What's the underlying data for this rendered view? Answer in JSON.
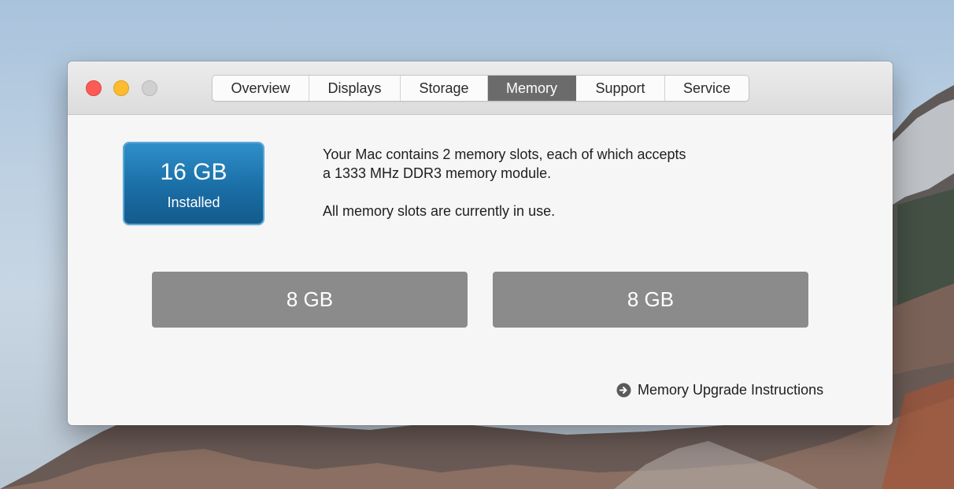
{
  "window": {
    "tabs": [
      {
        "label": "Overview",
        "active": false
      },
      {
        "label": "Displays",
        "active": false
      },
      {
        "label": "Storage",
        "active": false
      },
      {
        "label": "Memory",
        "active": true
      },
      {
        "label": "Support",
        "active": false
      },
      {
        "label": "Service",
        "active": false
      }
    ]
  },
  "memory": {
    "amount": "16 GB",
    "status": "Installed",
    "description_line1": "Your Mac contains 2 memory slots, each of which accepts",
    "description_line2": "a 1333 MHz DDR3 memory module.",
    "slots_status": "All memory slots are currently in use.",
    "slots": [
      {
        "label": "8 GB"
      },
      {
        "label": "8 GB"
      }
    ],
    "upgrade_link": "Memory Upgrade Instructions",
    "upgrade_icon": "arrow-circle-right-icon"
  },
  "colors": {
    "accent_blue": "#1a6ea6",
    "active_tab": "#6b6b6b",
    "slot_gray": "#8b8b8b",
    "close": "#fc5b56",
    "minimize": "#fdbc2e",
    "zoom_disabled": "#d0d0d0"
  }
}
